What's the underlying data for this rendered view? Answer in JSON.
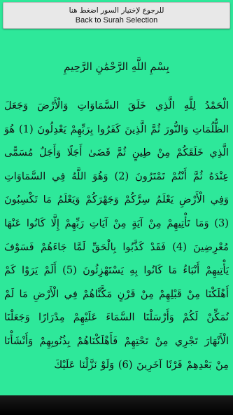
{
  "back_button": {
    "arabic_label": "للرجوع لإختيار السور اضغط هنا",
    "english_label": "Back to Surah Selection"
  },
  "basmala": "بِسْمِ اللَّهِ الرَّحْمَٰنِ الرَّحِيمِ",
  "ayah_text": "الْحَمْدُ لِلَّهِ الَّذِي خَلَقَ السَّمَاوَاتِ وَالْأَرْضَ وَجَعَلَ الظُّلُمَاتِ وَالنُّورَ ثُمَّ الَّذِينَ كَفَرُوا بِرَبِّهِمْ يَعْدِلُونَ (1) هُوَ الَّذِي خَلَقَكُمْ مِنْ طِينٍ ثُمَّ قَضَىٰ أَجَلًا وَأَجَلٌ مُسَمًّى عِنْدَهُ ثُمَّ أَنْتُمْ تَمْتَرُونَ (2) وَهُوَ اللَّهُ فِي السَّمَاوَاتِ وَفِي الْأَرْضِ يَعْلَمُ سِرَّكُمْ وَجَهْرَكُمْ وَيَعْلَمُ مَا تَكْسِبُونَ (3) وَمَا تَأْتِيهِمْ مِنْ آيَةٍ مِنْ آيَاتِ رَبِّهِمْ إِلَّا كَانُوا عَنْهَا مُعْرِضِينَ (4) فَقَدْ كَذَّبُوا بِالْحَقِّ لَمَّا جَاءَهُمْ فَسَوْفَ يَأْتِيهِمْ أَنْبَاءُ مَا كَانُوا بِهِ يَسْتَهْزِئُونَ (5) أَلَمْ يَرَوْا كَمْ أَهْلَكْنَا مِنْ قَبْلِهِمْ مِنْ قَرْنٍ مَكَّنَّاهُمْ فِي الْأَرْضِ مَا لَمْ نُمَكِّنْ لَكُمْ وَأَرْسَلْنَا السَّمَاءَ عَلَيْهِمْ مِدْرَارًا وَجَعَلْنَا الْأَنْهَارَ تَجْرِي مِنْ تَحْتِهِمْ فَأَهْلَكْنَاهُمْ بِذُنُوبِهِمْ وَأَنْشَأْنَا مِنْ بَعْدِهِمْ قَرْنًا آخَرِينَ (6) وَلَوْ نَزَّلْنَا عَلَيْكَ",
  "colors": {
    "background": "#2ee89a",
    "button": "#e8e8e8",
    "text": "#111111"
  }
}
